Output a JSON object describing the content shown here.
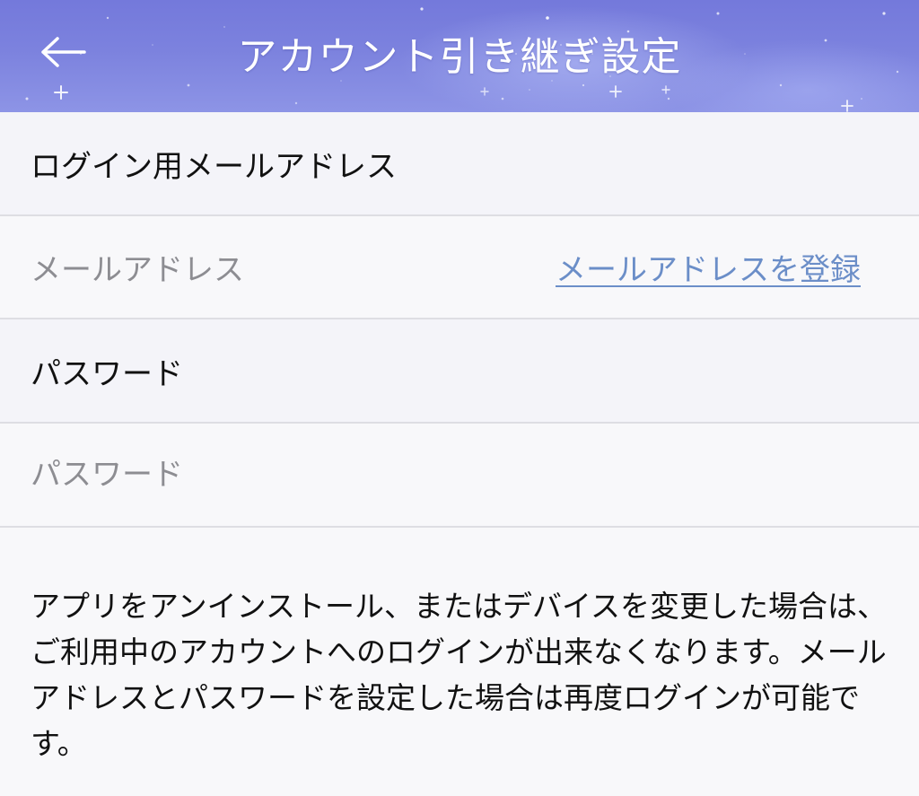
{
  "header": {
    "title": "アカウント引き継ぎ設定",
    "background_color": "#7c82de"
  },
  "email_section": {
    "label": "ログイン用メールアドレス",
    "field_placeholder": "メールアドレス",
    "register_link": "メールアドレスを登録",
    "link_color": "#6b8ec8"
  },
  "password_section": {
    "label": "パスワード",
    "field_placeholder": "パスワード",
    "field_value": ""
  },
  "notice": {
    "text": "アプリをアンインストール、またはデバイスを変更した場合は、ご利用中のアカウントへのログインが出来なくなります。メールアドレスとパスワードを設定した場合は再度ログインが可能です。"
  },
  "icons": {
    "back": "arrow-left-icon"
  }
}
